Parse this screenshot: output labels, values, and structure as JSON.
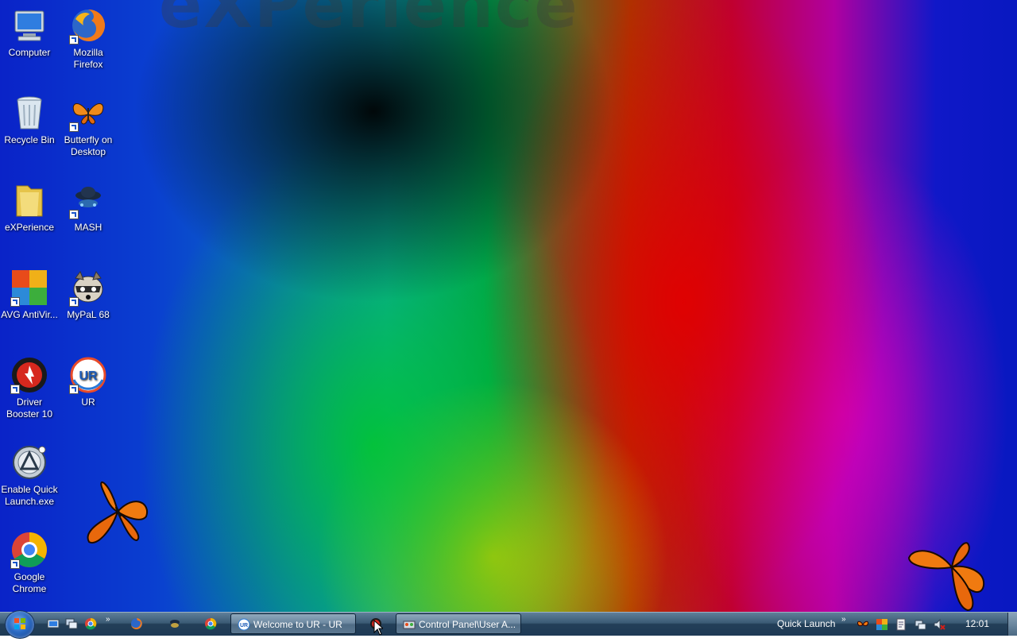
{
  "desktop": {
    "watermark": "eXPerience",
    "icons": [
      {
        "label": "Computer"
      },
      {
        "label": "Mozilla Firefox"
      },
      {
        "label": "Recycle Bin"
      },
      {
        "label": "Butterfly on Desktop"
      },
      {
        "label": "eXPerience"
      },
      {
        "label": "MASH"
      },
      {
        "label": "AVG AntiVir..."
      },
      {
        "label": "MyPaL 68"
      },
      {
        "label": "Driver Booster 10"
      },
      {
        "label": "UR"
      },
      {
        "label": "Enable Quick Launch.exe"
      },
      {
        "label": "Google Chrome"
      }
    ]
  },
  "taskbar": {
    "quick_launch_overflow": "»",
    "windows": [
      {
        "label": "Welcome to UR - UR",
        "icon": "ur-browser-icon"
      },
      {
        "label": "Control Panel\\User A...",
        "icon": "control-panel-icon"
      }
    ],
    "quick_launch_label": "Quick Launch",
    "tray_overflow": "»",
    "clock": "12:01"
  },
  "colors": {
    "taskbar_top": "#5f7f99",
    "taskbar_bottom": "#1e3a55",
    "start_orb": "#2c6bc4"
  }
}
